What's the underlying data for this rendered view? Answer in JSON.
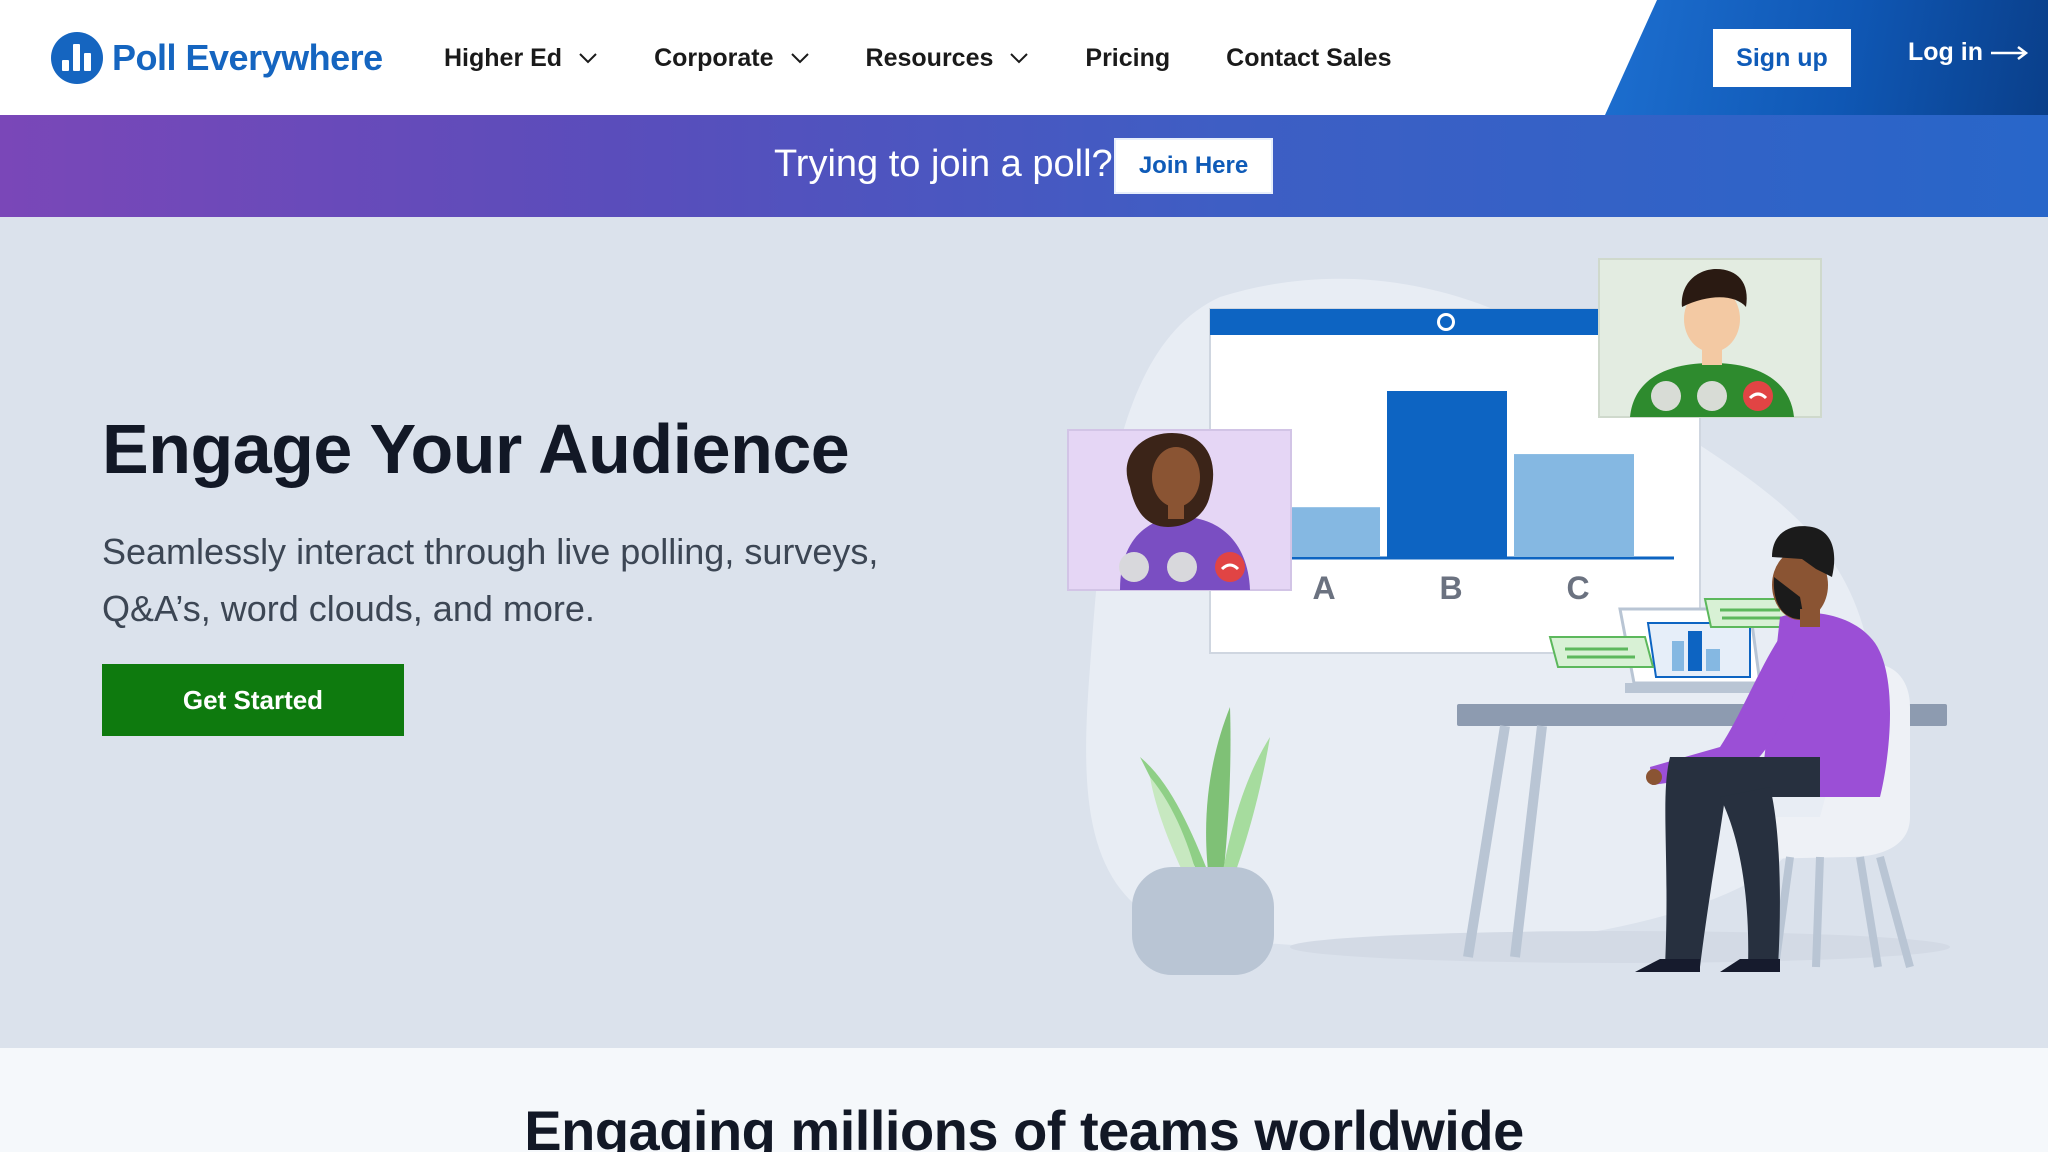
{
  "brand": {
    "name": "Poll Everywhere",
    "color": "#1565c0"
  },
  "nav": {
    "items": [
      {
        "label": "Higher Ed",
        "dropdown": true
      },
      {
        "label": "Corporate",
        "dropdown": true
      },
      {
        "label": "Resources",
        "dropdown": true
      },
      {
        "label": "Pricing",
        "dropdown": false
      },
      {
        "label": "Contact Sales",
        "dropdown": false
      }
    ],
    "signup_label": "Sign up",
    "login_label": "Log in"
  },
  "banner": {
    "text": "Trying to join a poll?",
    "button_label": "Join Here"
  },
  "hero": {
    "title": "Engage Your Audience",
    "subtitle": "Seamlessly interact through live polling, surveys, Q&A’s, word clouds, and more.",
    "cta_label": "Get Started",
    "cta_color": "#0e7a0e",
    "illustration": {
      "chart_labels": [
        "A",
        "B",
        "C"
      ],
      "chart_values": [
        0.3,
        1.0,
        0.62
      ]
    }
  },
  "bottom": {
    "title": "Engaging millions of teams worldwide"
  }
}
